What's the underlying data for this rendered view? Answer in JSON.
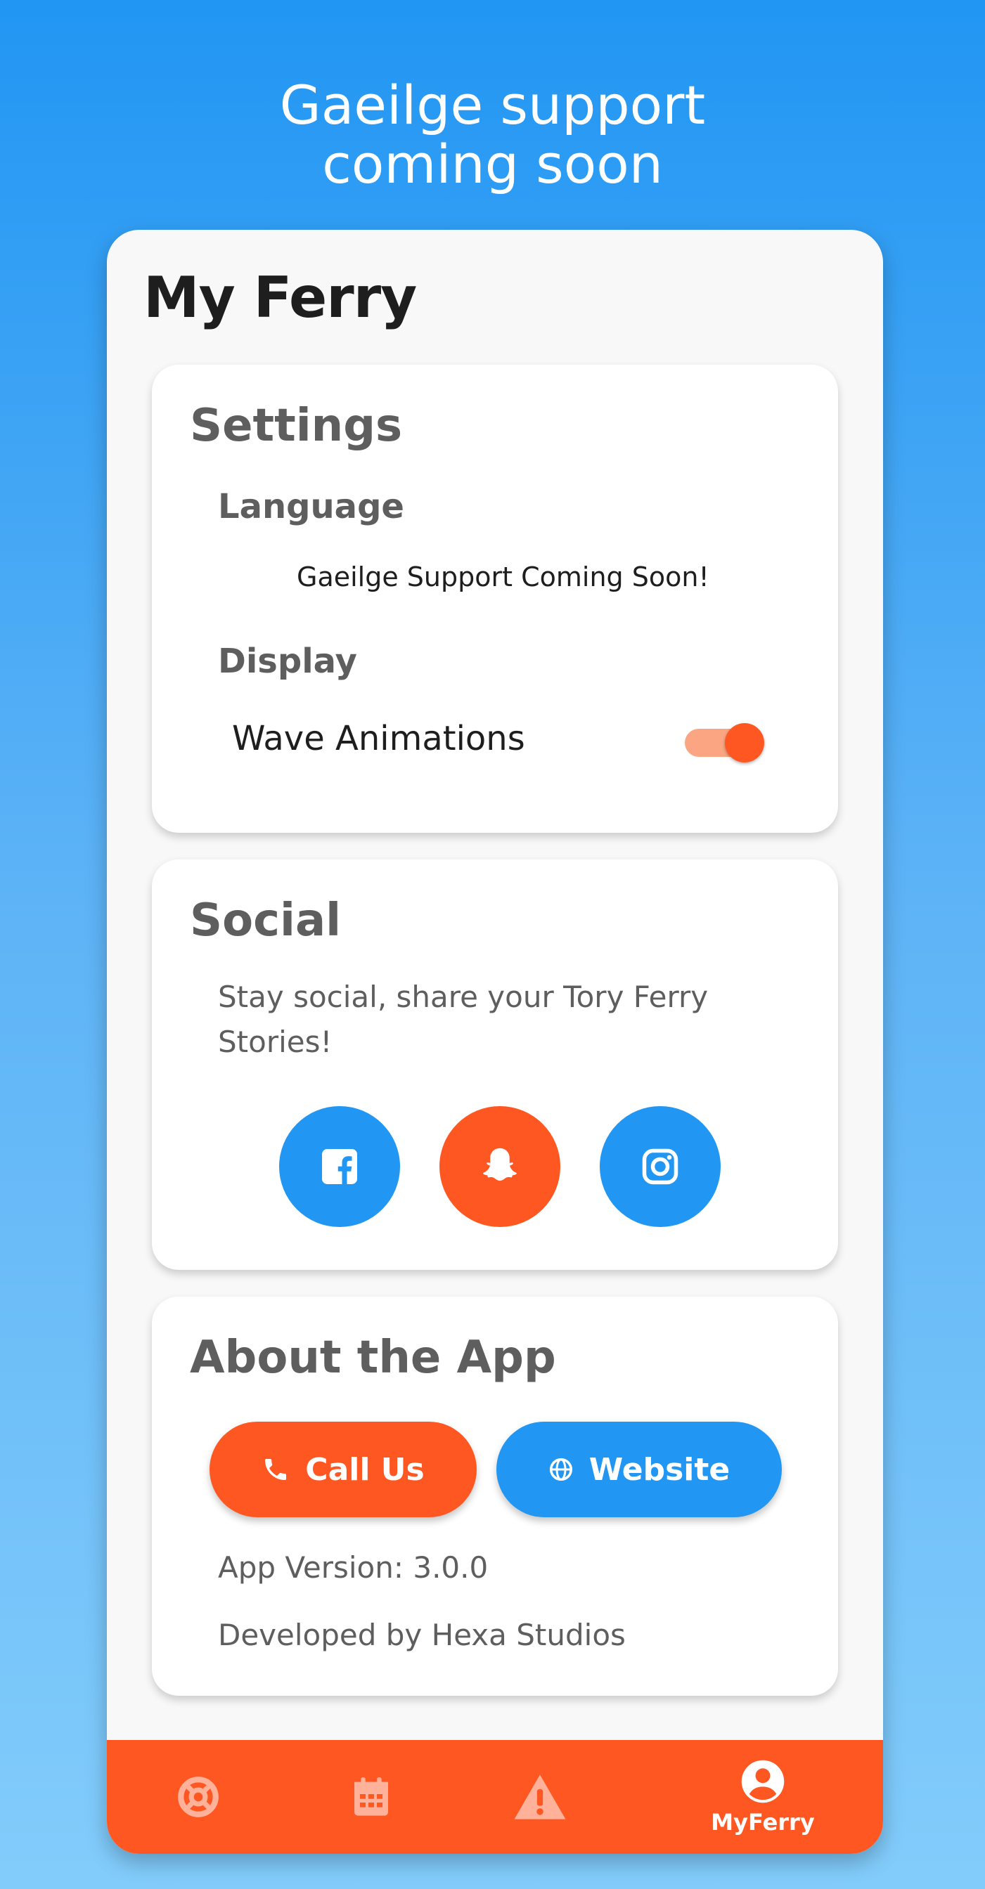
{
  "headline": [
    "Gaeilge support",
    "coming soon"
  ],
  "app_title": "My Ferry",
  "settings": {
    "title": "Settings",
    "language_heading": "Language",
    "language_text": "Gaeilge Support Coming Soon!",
    "display_heading": "Display",
    "wave_label": "Wave Animations",
    "wave_enabled": true
  },
  "social": {
    "title": "Social",
    "text": [
      "Stay social, share your Tory Ferry",
      "Stories!"
    ],
    "buttons": [
      {
        "icon": "facebook-icon",
        "color": "#2196F3"
      },
      {
        "icon": "snapchat-icon",
        "color": "#FF5722"
      },
      {
        "icon": "instagram-icon",
        "color": "#2196F3"
      }
    ]
  },
  "about": {
    "title": "About the App",
    "call_label": "Call Us",
    "website_label": "Website",
    "version": "App Version: 3.0.0",
    "developer": "Developed by Hexa Studios"
  },
  "nav": {
    "items": [
      {
        "icon": "lifebuoy-icon",
        "label": "",
        "active": false
      },
      {
        "icon": "calendar-icon",
        "label": "",
        "active": false
      },
      {
        "icon": "warning-icon",
        "label": "",
        "active": false
      },
      {
        "icon": "account-icon",
        "label": "MyFerry",
        "active": true
      }
    ]
  },
  "colors": {
    "primary_blue": "#2196F3",
    "accent_orange": "#FF5722",
    "card_bg": "#FFFFFF",
    "screen_bg": "#F8F8F8"
  }
}
